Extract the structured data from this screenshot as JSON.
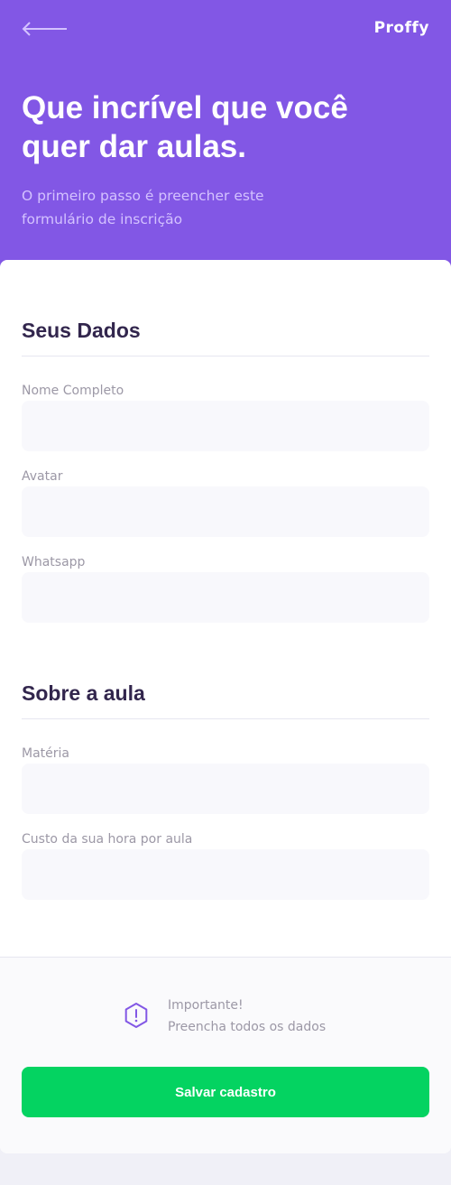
{
  "header": {
    "back_icon": "arrow-left-icon",
    "logo": "Proffy",
    "title": "Que incrível que você quer dar aulas.",
    "subtitle": "O primeiro passo é preencher este formulário de inscrição",
    "background_color": "#8257e5"
  },
  "form": {
    "sections": [
      {
        "legend": "Seus Dados",
        "fields": [
          {
            "label": "Nome Completo",
            "value": "",
            "placeholder": ""
          },
          {
            "label": "Avatar",
            "value": "",
            "placeholder": ""
          },
          {
            "label": "Whatsapp",
            "value": "",
            "placeholder": ""
          }
        ]
      },
      {
        "legend": "Sobre a aula",
        "fields": [
          {
            "label": "Matéria",
            "value": "",
            "placeholder": ""
          },
          {
            "label": "Custo da sua hora por aula",
            "value": "",
            "placeholder": ""
          }
        ]
      }
    ]
  },
  "footer": {
    "warning_icon": "warning-icon",
    "warning_title": "Importante!",
    "warning_text": "Preencha todos os dados",
    "save_label": "Salvar cadastro",
    "save_color": "#04d361"
  }
}
